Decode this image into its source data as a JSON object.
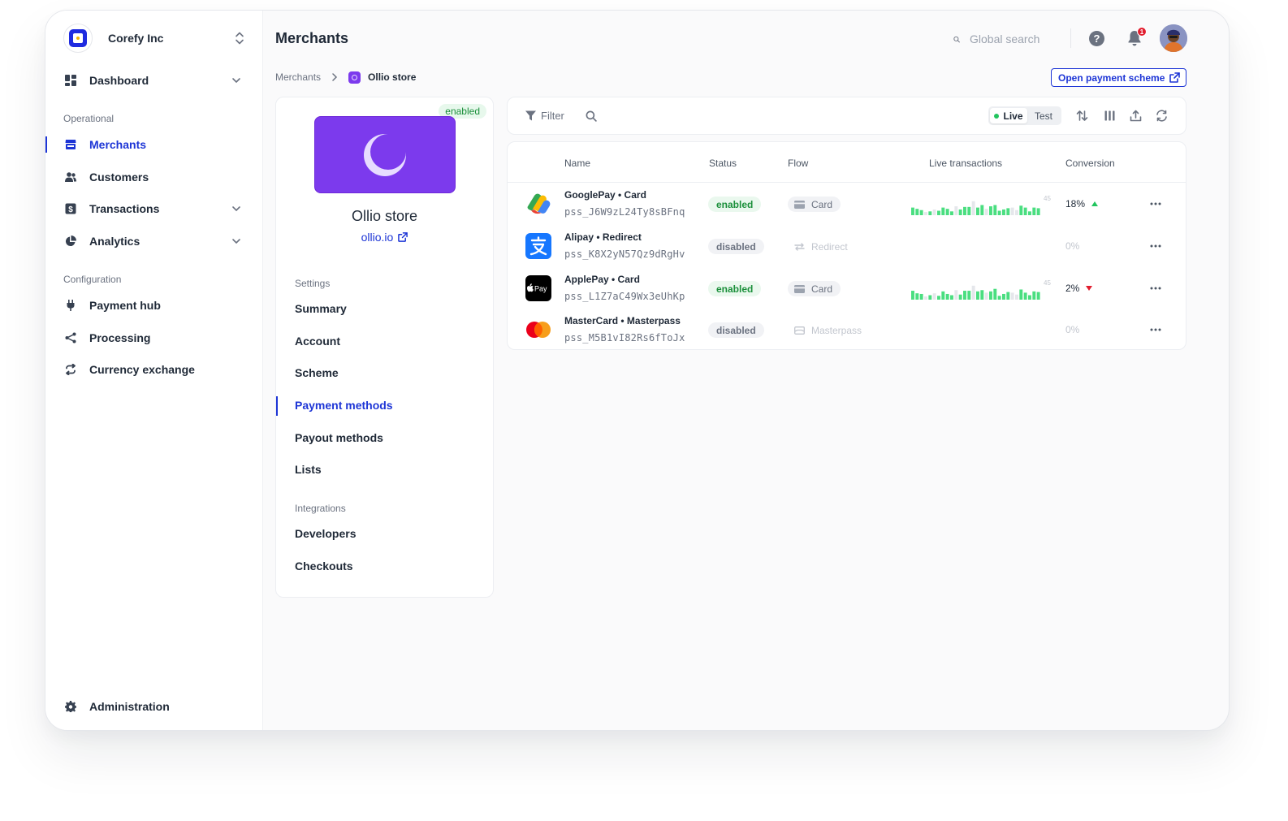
{
  "company": {
    "name": "Corefy Inc"
  },
  "sidebar": {
    "items": [
      {
        "label": "Dashboard",
        "icon": "dashboard-icon"
      },
      {
        "label": "Merchants",
        "icon": "store-icon",
        "active": true
      },
      {
        "label": "Customers",
        "icon": "users-icon"
      },
      {
        "label": "Transactions",
        "icon": "dollar-icon"
      },
      {
        "label": "Analytics",
        "icon": "pie-chart-icon"
      },
      {
        "label": "Payment hub",
        "icon": "plug-icon"
      },
      {
        "label": "Processing",
        "icon": "share-icon"
      },
      {
        "label": "Currency exchange",
        "icon": "exchange-icon"
      },
      {
        "label": "Administration",
        "icon": "gear-icon"
      }
    ],
    "sections": {
      "operational": "Operational",
      "configuration": "Configuration"
    }
  },
  "header": {
    "title": "Merchants",
    "search_placeholder": "Global search",
    "notification_count": "1"
  },
  "breadcrumb": {
    "root": "Merchants",
    "current": "Ollio store"
  },
  "open_scheme_label": "Open payment scheme",
  "merchant": {
    "status": "enabled",
    "name": "Ollio store",
    "website": "ollio.io",
    "settings_label": "Settings",
    "settings": [
      "Summary",
      "Account",
      "Scheme",
      "Payment methods",
      "Payout methods",
      "Lists"
    ],
    "active_setting": "Payment methods",
    "integrations_label": "Integrations",
    "integrations": [
      "Developers",
      "Checkouts"
    ]
  },
  "toolbar": {
    "filter_label": "Filter",
    "live_label": "Live",
    "test_label": "Test"
  },
  "table": {
    "columns": [
      "Name",
      "Status",
      "Flow",
      "Live transactions",
      "Conversion"
    ],
    "spark_max": "45",
    "rows": [
      {
        "name": "GooglePay • Card",
        "id": "pss_J6W9zL24Ty8sBFnq",
        "status": "enabled",
        "flow": "Card",
        "conversion": "18%",
        "trend": "up",
        "spark": [
          12,
          10,
          8,
          5,
          6,
          9,
          7,
          12,
          10,
          6,
          14,
          9,
          13,
          13,
          22,
          12,
          16,
          10,
          14,
          16,
          7,
          9,
          11,
          12,
          8,
          15,
          12,
          6,
          12,
          11
        ]
      },
      {
        "name": "Alipay • Redirect",
        "id": "pss_K8X2yN57Qz9dRgHv",
        "status": "disabled",
        "flow": "Redirect",
        "conversion": "0%",
        "trend": "none",
        "spark": []
      },
      {
        "name": "ApplePay • Card",
        "id": "pss_L1Z7aC49Wx3eUhKp",
        "status": "enabled",
        "flow": "Card",
        "conversion": "2%",
        "trend": "down",
        "spark": [
          14,
          10,
          9,
          5,
          7,
          10,
          6,
          13,
          9,
          7,
          15,
          8,
          14,
          14,
          22,
          13,
          15,
          11,
          13,
          17,
          6,
          9,
          12,
          11,
          8,
          16,
          11,
          7,
          13,
          12
        ]
      },
      {
        "name": "MasterCard • Masterpass",
        "id": "pss_M5B1vI82Rs6fToJx",
        "status": "disabled",
        "flow": "Masterpass",
        "conversion": "0%",
        "trend": "none",
        "spark": []
      }
    ]
  },
  "colors": {
    "accent": "#1d35d6",
    "store_purple": "#7c3aed",
    "enabled_green": "#1a8f3a",
    "spark_green": "#4ade80",
    "spark_light": "#e5e7eb",
    "trend_up": "#22c55e",
    "trend_down": "#e11d2e"
  }
}
